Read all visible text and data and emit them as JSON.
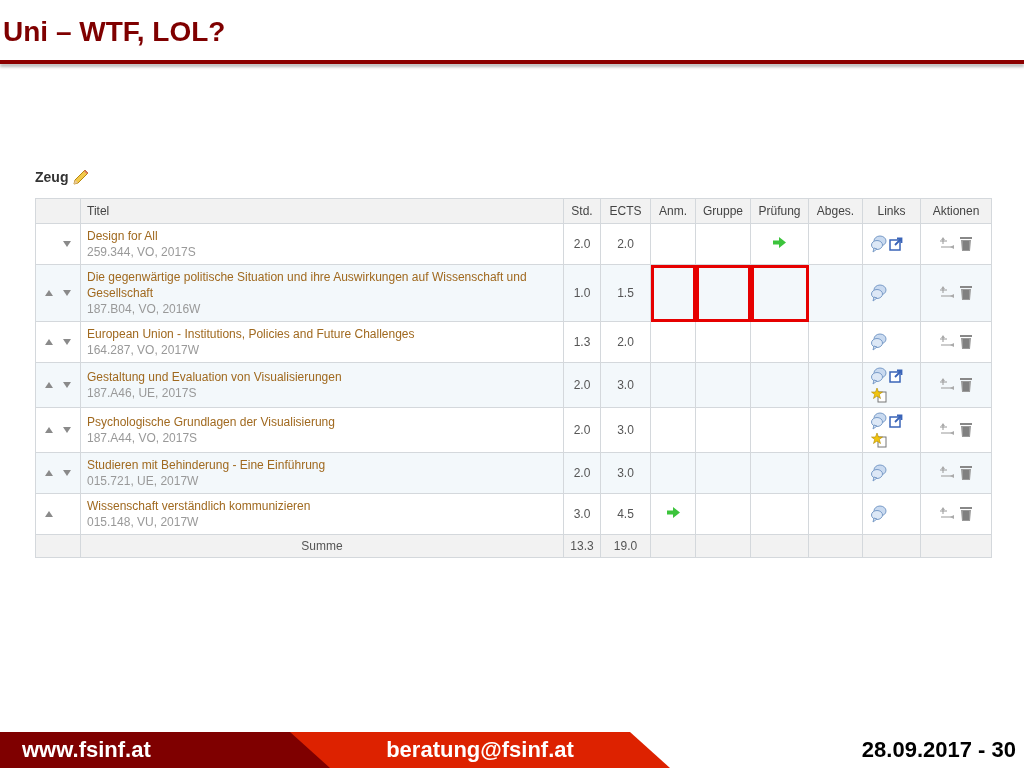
{
  "slide": {
    "title": "Uni – WTF, LOL?"
  },
  "section": {
    "title": "Zeug"
  },
  "table": {
    "columns": [
      "Titel",
      "Std.",
      "ECTS",
      "Anm.",
      "Gruppe",
      "Prüfung",
      "Abges.",
      "Links",
      "Aktionen"
    ],
    "rows": [
      {
        "up": false,
        "down": true,
        "title": "Design for All",
        "meta": "259.344, VO, 2017S",
        "std": "2.0",
        "ects": "2.0",
        "anm_arrow": false,
        "pruefung_arrow": true,
        "external_link": true,
        "favorite": false,
        "highlighted": false
      },
      {
        "up": true,
        "down": true,
        "title": "Die gegenwärtige politische Situation und ihre Auswirkungen auf Wissenschaft und Gesellschaft",
        "meta": "187.B04, VO, 2016W",
        "std": "1.0",
        "ects": "1.5",
        "anm_arrow": false,
        "pruefung_arrow": false,
        "external_link": false,
        "favorite": false,
        "highlighted": true
      },
      {
        "up": true,
        "down": true,
        "title": "European Union - Institutions, Policies and Future Challenges",
        "meta": "164.287, VO, 2017W",
        "std": "1.3",
        "ects": "2.0",
        "anm_arrow": false,
        "pruefung_arrow": false,
        "external_link": false,
        "favorite": false,
        "highlighted": false
      },
      {
        "up": true,
        "down": true,
        "title": "Gestaltung und Evaluation von Visualisierungen",
        "meta": "187.A46, UE, 2017S",
        "std": "2.0",
        "ects": "3.0",
        "anm_arrow": false,
        "pruefung_arrow": false,
        "external_link": true,
        "favorite": true,
        "highlighted": false
      },
      {
        "up": true,
        "down": true,
        "title": "Psychologische Grundlagen der Visualisierung",
        "meta": "187.A44, VO, 2017S",
        "std": "2.0",
        "ects": "3.0",
        "anm_arrow": false,
        "pruefung_arrow": false,
        "external_link": true,
        "favorite": true,
        "highlighted": false
      },
      {
        "up": true,
        "down": true,
        "title": "Studieren mit Behinderung - Eine Einführung",
        "meta": "015.721, UE, 2017W",
        "std": "2.0",
        "ects": "3.0",
        "anm_arrow": false,
        "pruefung_arrow": false,
        "external_link": false,
        "favorite": false,
        "highlighted": false
      },
      {
        "up": true,
        "down": false,
        "title": "Wissenschaft verständlich kommunizieren",
        "meta": "015.148, VU, 2017W",
        "std": "3.0",
        "ects": "4.5",
        "anm_arrow": true,
        "pruefung_arrow": false,
        "external_link": false,
        "favorite": false,
        "highlighted": false
      }
    ],
    "sum": {
      "label": "Summe",
      "std": "13.3",
      "ects": "19.0"
    }
  },
  "footer": {
    "website": "www.fsinf.at",
    "email": "beratung@fsinf.at",
    "date_page": "28.09.2017 - 30"
  }
}
